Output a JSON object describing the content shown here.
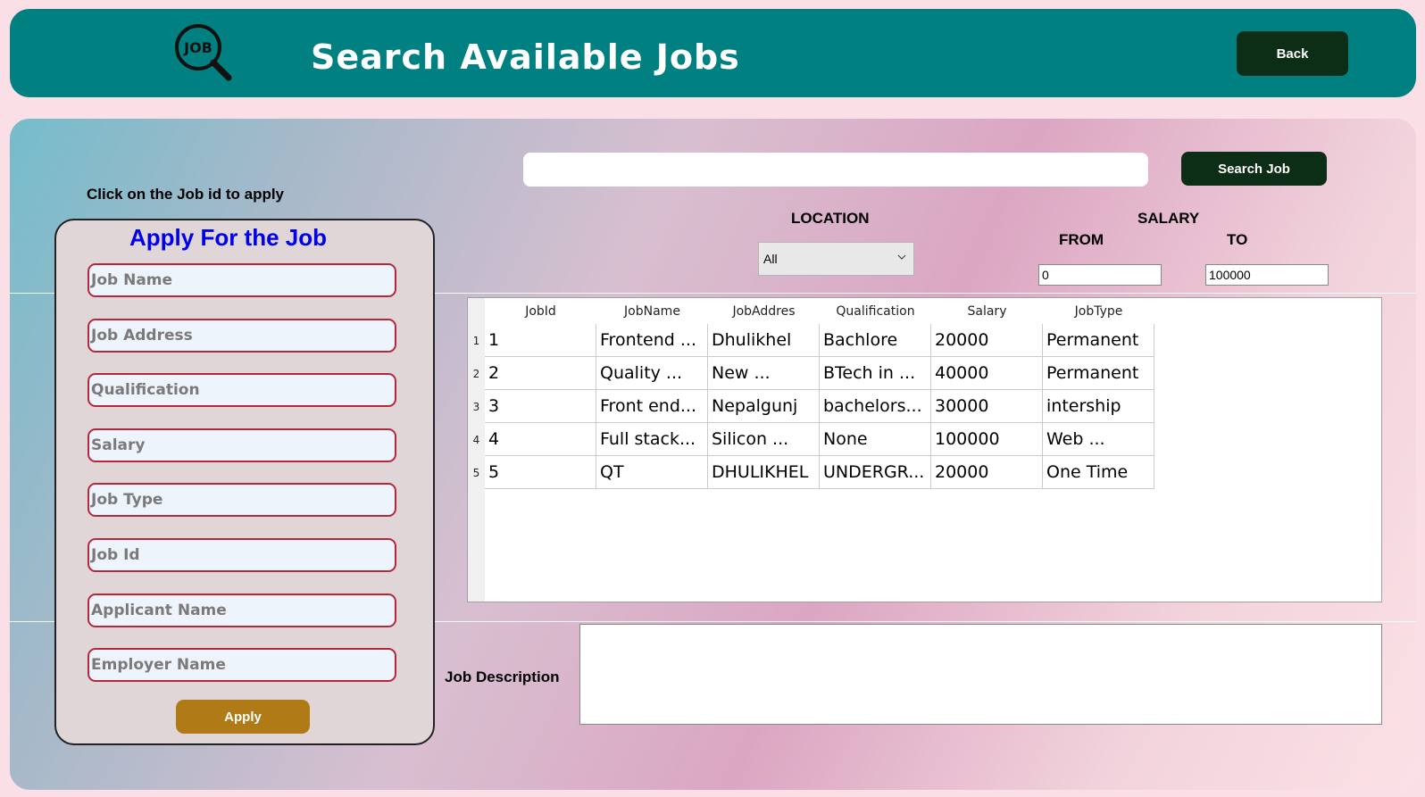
{
  "header": {
    "logo_text": "JOB",
    "title": "Search Available Jobs",
    "back_label": "Back"
  },
  "apply": {
    "hint": "Click on the Job id to apply",
    "title": "Apply For the Job",
    "fields": {
      "job_name": "Job Name",
      "job_address": "Job Address",
      "qualification": "Qualification",
      "salary": "Salary",
      "job_type": "Job Type",
      "job_id": "Job Id",
      "applicant_name": "Applicant Name",
      "employer_name": "Employer Name"
    },
    "apply_label": "Apply"
  },
  "search": {
    "value": "",
    "button_label": "Search Job"
  },
  "filters": {
    "location_label": "LOCATION",
    "location_value": "All",
    "salary_label": "SALARY",
    "from_label": "FROM",
    "to_label": "TO",
    "from_value": "0",
    "to_value": "100000"
  },
  "table": {
    "columns": [
      "JobId",
      "JobName",
      "JobAddres",
      "Qualification",
      "Salary",
      "JobType"
    ],
    "rows": [
      {
        "n": "1",
        "cells": [
          "1",
          "Frontend ...",
          "Dhulikhel",
          "Bachlore",
          "20000",
          "Permanent"
        ]
      },
      {
        "n": "2",
        "cells": [
          "2",
          "Quality ...",
          "New ...",
          "BTech in ...",
          "40000",
          "Permanent"
        ]
      },
      {
        "n": "3",
        "cells": [
          "3",
          "Front end...",
          "Nepalgunj",
          "bachelors...",
          "30000",
          "intership"
        ]
      },
      {
        "n": "4",
        "cells": [
          "4",
          "Full stack...",
          "Silicon ...",
          "None",
          "100000",
          "Web ..."
        ]
      },
      {
        "n": "5",
        "cells": [
          "5",
          "QT",
          "DHULIKHEL",
          "UNDERGR...",
          "20000",
          "One Time"
        ]
      }
    ]
  },
  "description": {
    "label": "Job Description",
    "value": ""
  }
}
